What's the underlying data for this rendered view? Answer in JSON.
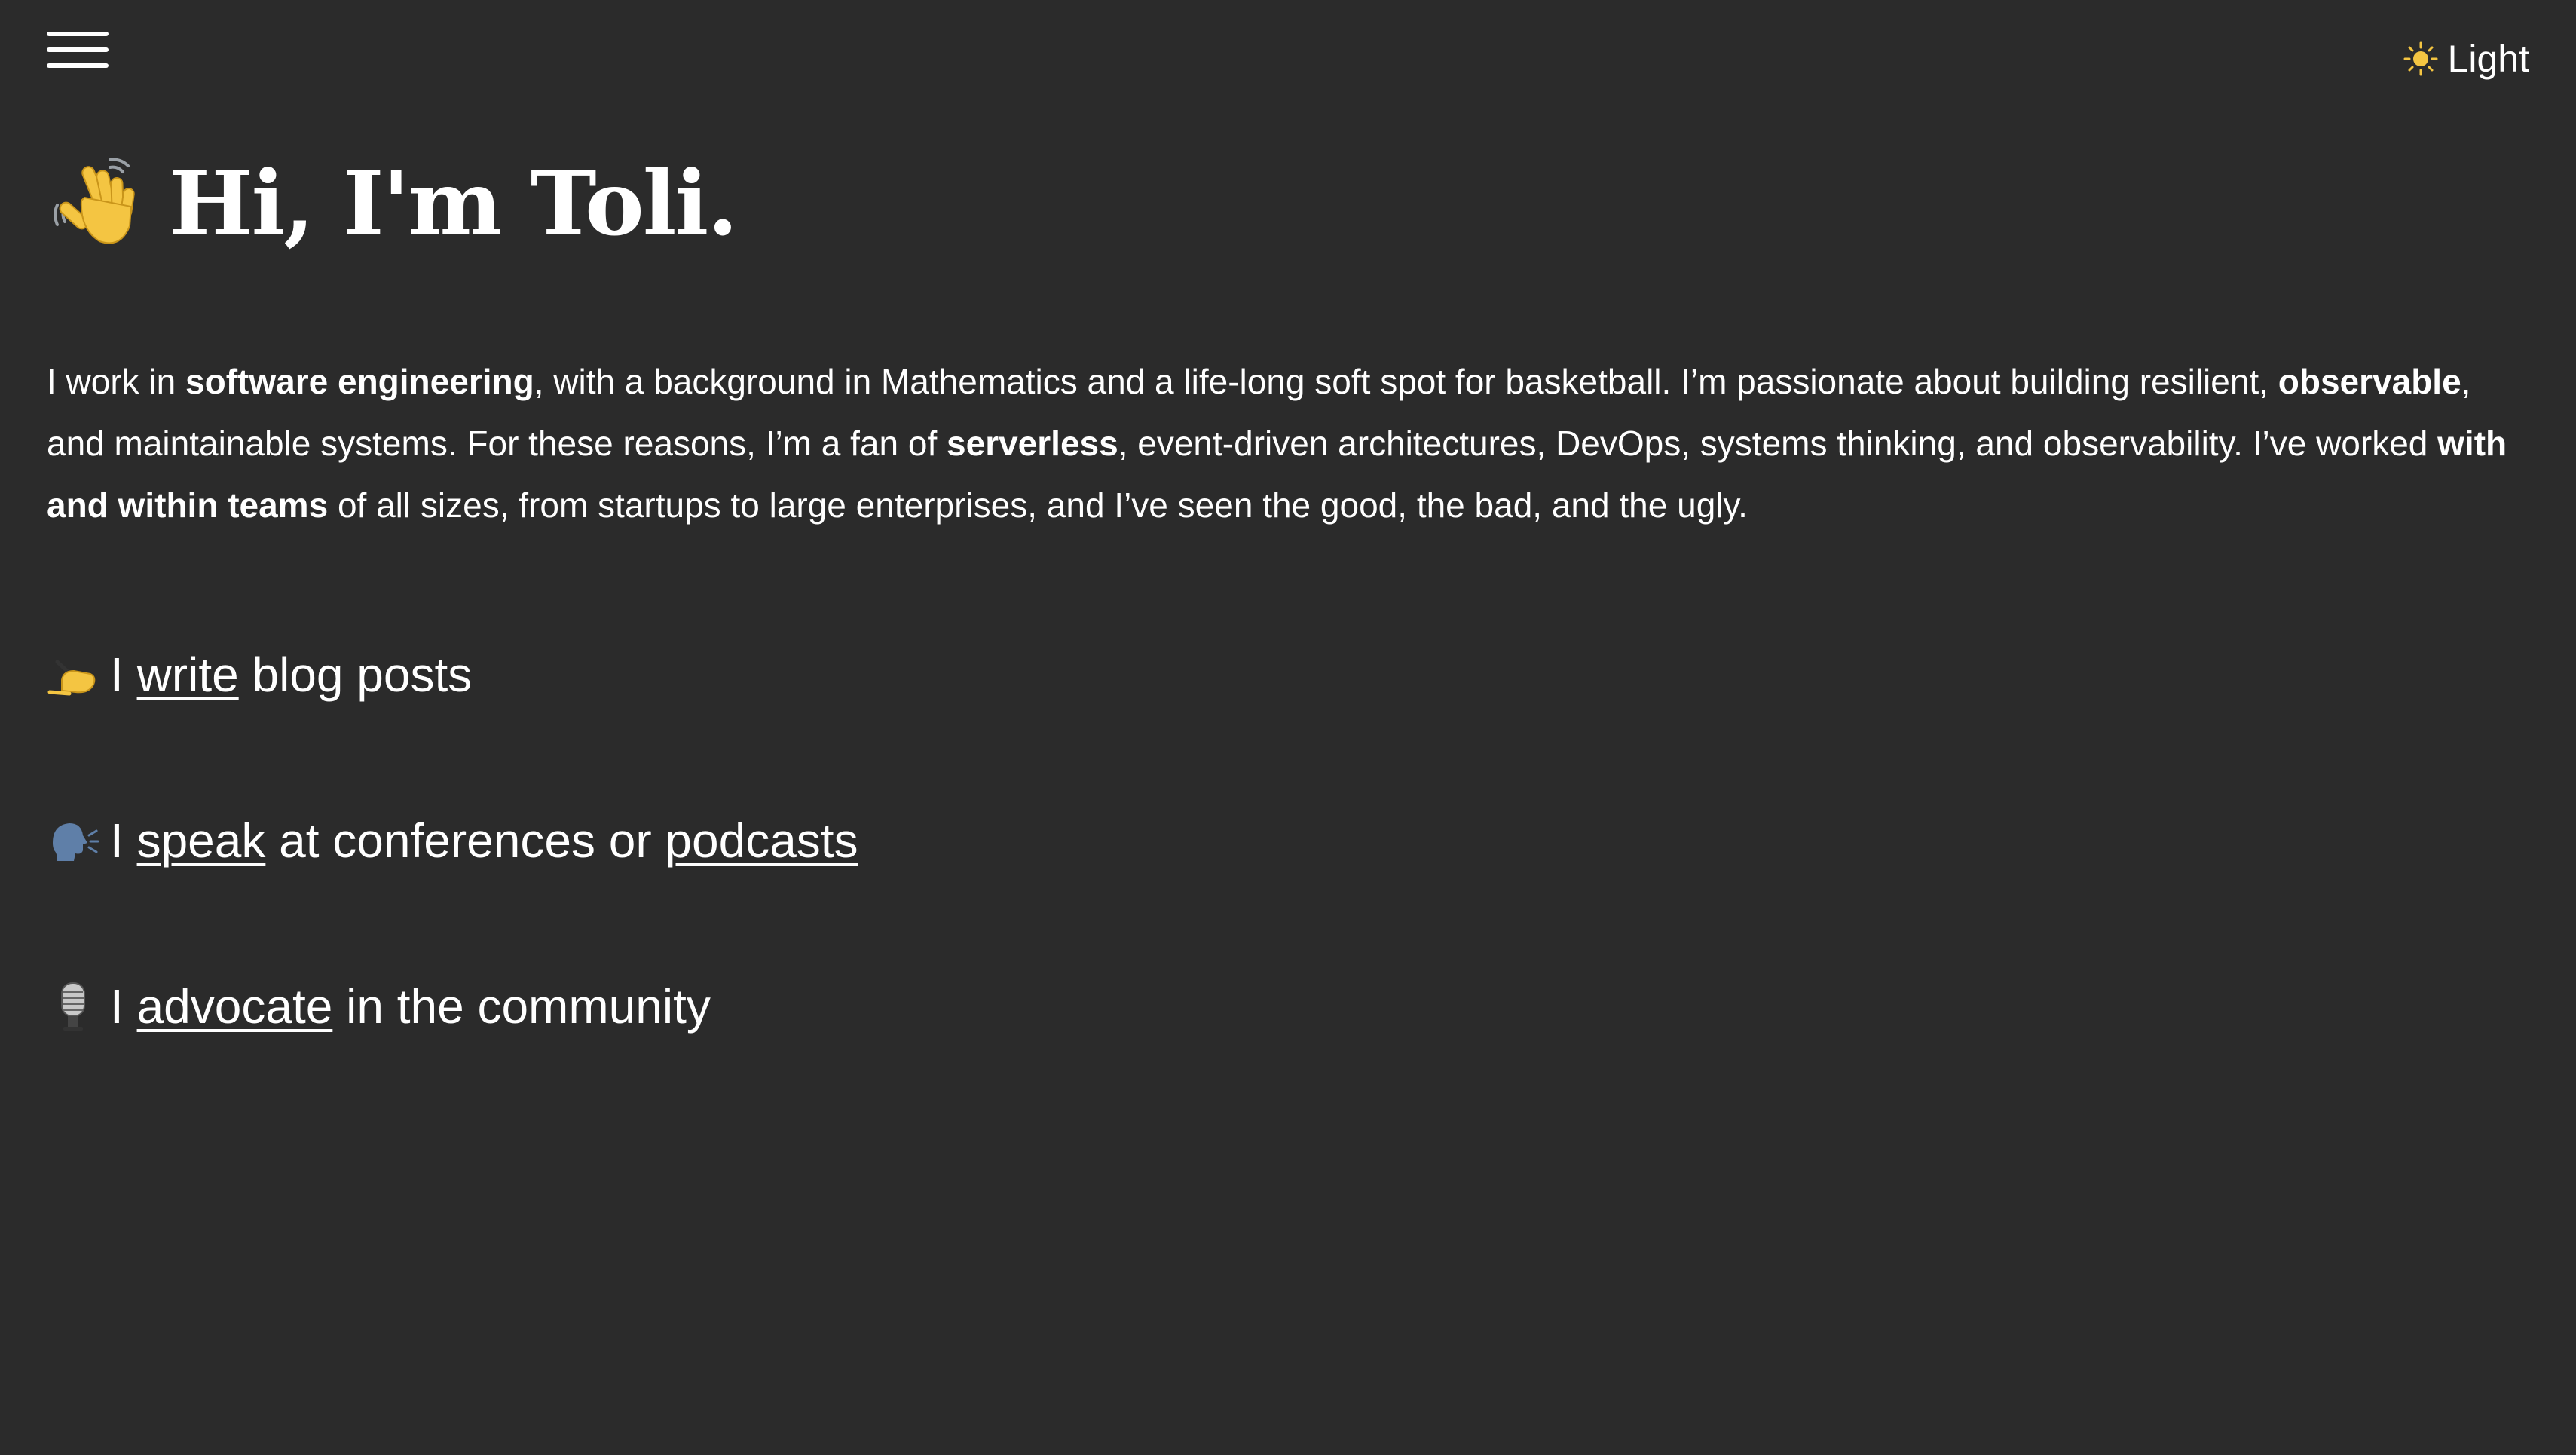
{
  "header": {
    "menu_icon": "hamburger-menu-icon",
    "theme_toggle": {
      "icon": "sun-icon",
      "label": "Light"
    }
  },
  "hero": {
    "icon": "waving-hand-icon",
    "title": "Hi, I'm Toli."
  },
  "intro": {
    "p1": "I work in ",
    "b1": "software engineering",
    "p2": ", with a background in Mathematics and a life-long soft spot for basketball. I’m passionate about building resilient, ",
    "b2": "observable",
    "p3": ", and maintainable systems. For these reasons, I’m a fan of ",
    "b3": "serverless",
    "p4": ", event-driven architectures, DevOps, systems thinking, and observability. I’ve worked ",
    "b4": "with and within teams",
    "p5": " of all sizes, from startups to large enterprises, and I’ve seen the good, the bad, and the ugly."
  },
  "items": {
    "write": {
      "icon": "writing-hand-icon",
      "prefix": "I",
      "link": "write",
      "suffix": "blog posts"
    },
    "speak": {
      "icon": "speaking-head-icon",
      "prefix": "I",
      "link1": "speak",
      "middle": "at conferences or",
      "link2": "podcasts"
    },
    "advocate": {
      "icon": "microphone-icon",
      "prefix": "I",
      "link": "advocate",
      "suffix": "in the community"
    }
  },
  "colors": {
    "background": "#2b2b2b",
    "text": "#ffffff",
    "emoji_yellow": "#f4c542"
  }
}
